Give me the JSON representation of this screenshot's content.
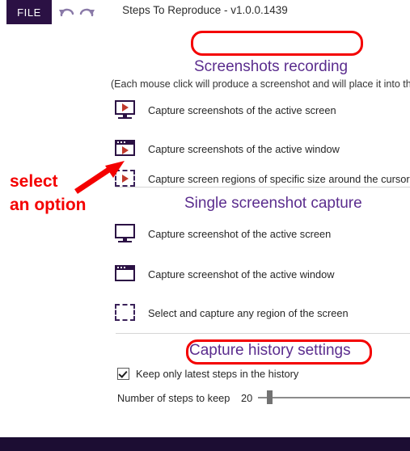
{
  "titlebar": {
    "file_label": "FILE",
    "undo_icon": "undo-arrow-icon",
    "redo_icon": "redo-arrow-icon",
    "app_title": "Steps To Reproduce - v1.0.0.1439"
  },
  "sections": {
    "recording": {
      "heading": "Screenshots recording",
      "note": "(Each mouse click will produce a screenshot and will place it into the h",
      "options": [
        {
          "label": "Capture screenshots of the active screen",
          "icon": "monitor-play-icon"
        },
        {
          "label": "Capture screenshots of the active window",
          "icon": "window-play-icon"
        },
        {
          "label": "Capture screen regions of specific size around the cursor",
          "icon": "dashed-region-play-icon"
        }
      ]
    },
    "single": {
      "heading": "Single screenshot capture",
      "options": [
        {
          "label": "Capture screenshot of the active screen",
          "icon": "monitor-icon"
        },
        {
          "label": "Capture screenshot of the active window",
          "icon": "window-icon"
        },
        {
          "label": "Select and capture any region of the screen",
          "icon": "dashed-region-icon"
        }
      ]
    },
    "history": {
      "heading": "Capture history settings",
      "checkbox_label": "Keep only latest steps in the history",
      "checkbox_checked": true,
      "slider_label": "Number of steps to keep",
      "slider_value": "20"
    }
  },
  "annotations": {
    "select_line1": "select",
    "select_line2": "an option",
    "arrow_icon": "red-arrow-icon",
    "highlight_color": "#f40000"
  },
  "colors": {
    "accent_purple": "#5b2d8e",
    "dark_purple": "#2b1144",
    "annotation_red": "#f40000",
    "play_red": "#c0392b"
  }
}
